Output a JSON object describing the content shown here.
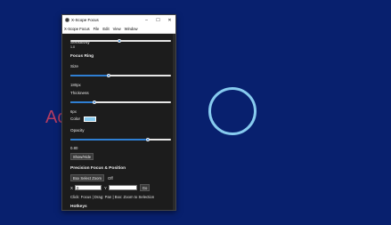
{
  "background": {
    "partial_text": "Ac",
    "colors": {
      "desktop": "#08206e",
      "ring": "#87cbef",
      "partial_text": "#d2415f"
    }
  },
  "window": {
    "title": "X-Scope Focus",
    "controls": {
      "minimize": "–",
      "maximize": "☐",
      "close": "✕"
    },
    "menu": [
      "X-Scope Focus",
      "File",
      "Edit",
      "View",
      "Window"
    ]
  },
  "panel": {
    "sensitivity": {
      "label": "Sensitivity",
      "value_text": "1.0",
      "level": 0.5
    },
    "focus_ring_title": "Focus Ring",
    "size": {
      "label": "Size",
      "value_text": "180px",
      "level": 0.38
    },
    "thickness": {
      "label": "Thickness",
      "value_text": "6px",
      "level": 0.24
    },
    "color": {
      "label": "Color",
      "swatch": "#87cbef"
    },
    "opacity": {
      "label": "Opacity",
      "value_text": "0.80",
      "level": 0.77
    },
    "show_hide_label": "Show/Hide",
    "precision_title": "Precision Focus & Position",
    "box_zoom_label": "Box Select Zoom",
    "box_zoom_state": "Off",
    "x_label": "X",
    "x_value": "0",
    "y_label": "Y",
    "y_value": "",
    "go_label": "Go",
    "hint": "Click: Focus | Drag: Pan | Box: Zoom to Selection",
    "hotkeys_title": "Hotkeys"
  }
}
